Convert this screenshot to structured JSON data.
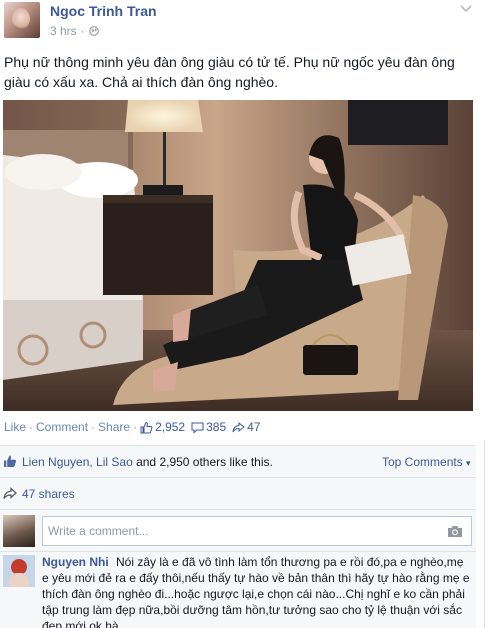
{
  "post": {
    "author": "Ngoc Trinh Tran",
    "time": "3 hrs",
    "status": "Phụ nữ thông minh yêu đàn ông giàu có tử tế. Phụ nữ ngốc yêu đàn ông giàu có xấu xa. Chả ai thích đàn ông nghèo."
  },
  "actions": {
    "like": "Like",
    "comment": "Comment",
    "share": "Share",
    "like_count": "2,952",
    "comment_count": "385",
    "share_count": "47"
  },
  "ufi": {
    "likes_names": "Lien Nguyen, Lil Sao",
    "likes_rest": " and 2,950 others like this.",
    "top_comments": "Top Comments",
    "shares": "47 shares",
    "comment_placeholder": "Write a comment..."
  },
  "comment": {
    "author": "Nguyen Nhi",
    "text": "Nói zây là e đã vô tình làm tổn thương pa e rồi đó,pa e nghèo,mẹ e yêu mới đẻ ra e đấy thôi,nếu thấy tự hào về bản thân thì hãy tự hào rằng mẹ e thích đàn ông nghèo đi...hoặc ngược lại,e chọn cái nào...Chị nghĩ e ko cần phải tập trung làm đẹp nữa,bồi dưỡng tâm hồn,tư tưởng sao cho tỷ lệ thuận với sắc đẹp mới ok hà"
  },
  "icons": [
    "globe-icon",
    "chevron-down-icon",
    "like-thumb-icon",
    "comment-icon",
    "share-arrow-icon",
    "camera-icon"
  ],
  "colors": {
    "link": "#3b5998",
    "muted": "#9197a3",
    "ufi_bg": "#f6f7f8"
  }
}
